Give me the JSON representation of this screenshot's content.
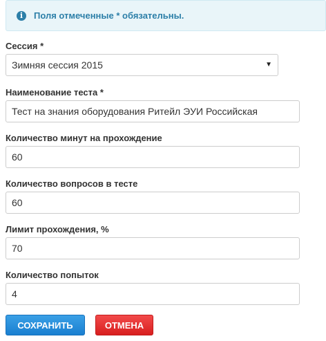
{
  "alert": {
    "icon": "info-icon",
    "text": "Поля отмеченные * обязательны."
  },
  "form": {
    "session": {
      "label": "Сессия *",
      "value": "Зимняя сессия 2015"
    },
    "test_name": {
      "label": "Наименование теста *",
      "value": "Тест на знания оборудования Ритейл ЭУИ Российская"
    },
    "minutes": {
      "label": "Количество минут на прохождение",
      "value": "60"
    },
    "questions": {
      "label": "Количество вопросов в тесте",
      "value": "60"
    },
    "pass_limit": {
      "label": "Лимит прохождения, %",
      "value": "70"
    },
    "attempts": {
      "label": "Количество попыток",
      "value": "4"
    }
  },
  "buttons": {
    "save": "Сохранить",
    "cancel": "Отмена"
  },
  "colors": {
    "alert_text": "#2c7fa8",
    "save_button": "#1f87d8",
    "cancel_button": "#e02b2b"
  }
}
